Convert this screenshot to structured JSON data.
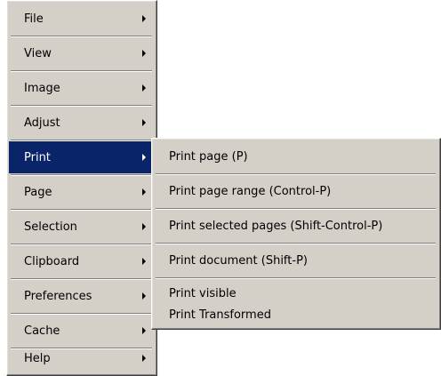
{
  "main_menu": {
    "items": [
      {
        "label": "File"
      },
      {
        "label": "View"
      },
      {
        "label": "Image"
      },
      {
        "label": "Adjust"
      },
      {
        "label": "Print"
      },
      {
        "label": "Page"
      },
      {
        "label": "Selection"
      },
      {
        "label": "Clipboard"
      },
      {
        "label": "Preferences"
      },
      {
        "label": "Cache"
      },
      {
        "label": "Help"
      }
    ],
    "selected": "Print"
  },
  "print_submenu": {
    "items": [
      {
        "label": "Print page (P)"
      },
      {
        "label": "Print page range (Control-P)"
      },
      {
        "label": "Print selected pages (Shift-Control-P)"
      },
      {
        "label": "Print document (Shift-P)"
      },
      {
        "label": "Print visible"
      },
      {
        "label": "Print Transformed"
      }
    ]
  },
  "colors": {
    "menu_background": "#d4d0c8",
    "highlight_background": "#0a246a",
    "highlight_text": "#ffffff"
  },
  "icons": {
    "submenu_arrow": "chevron-right-icon"
  }
}
